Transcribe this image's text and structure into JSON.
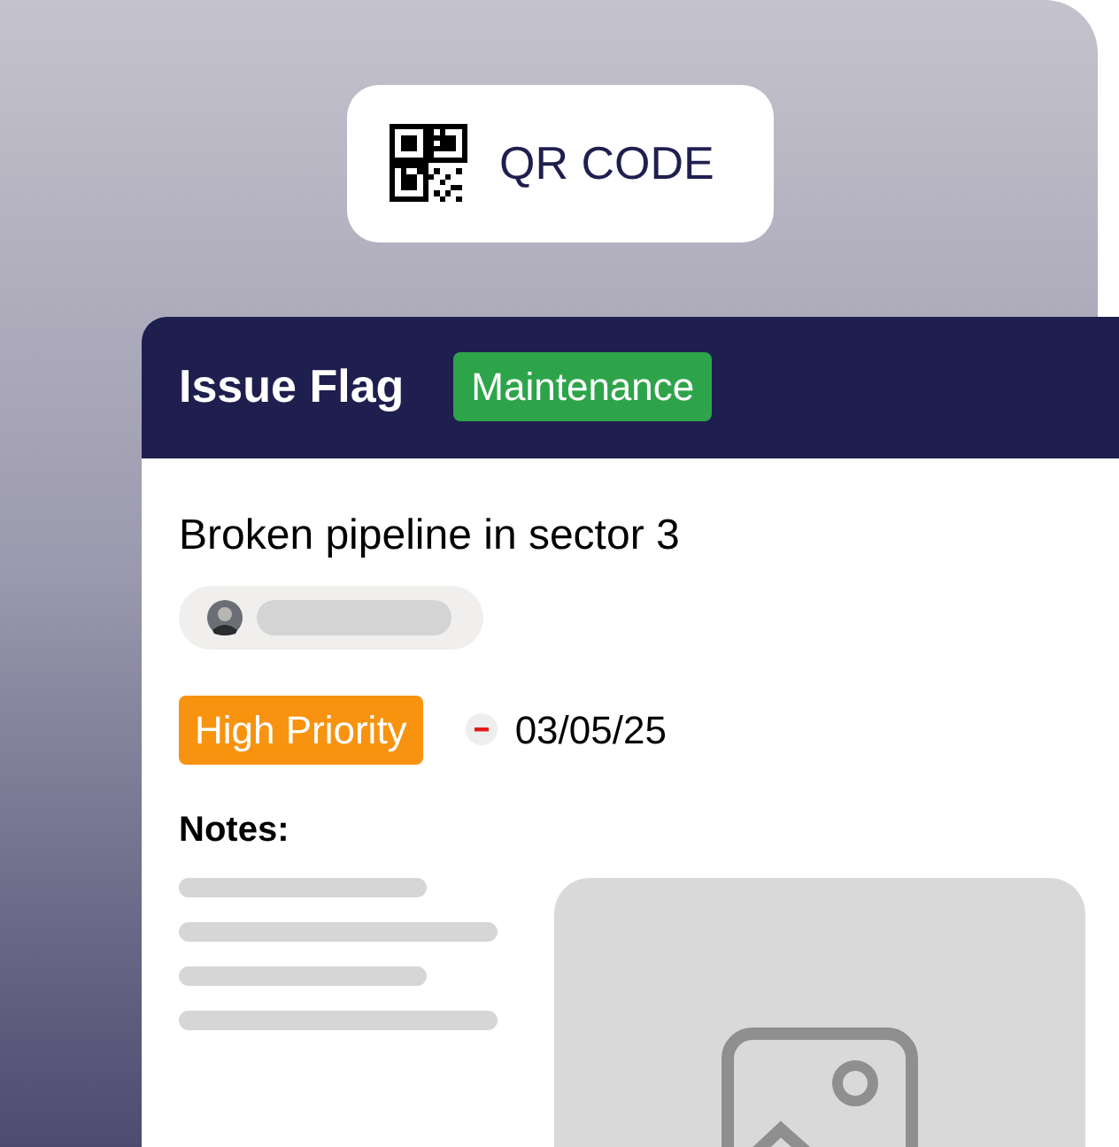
{
  "qr_button": {
    "label": "QR CODE"
  },
  "card": {
    "title": "Issue Flag",
    "tag": "Maintenance",
    "issue": "Broken pipeline in sector 3",
    "priority": "High Priority",
    "date": "03/05/25",
    "notes_label": "Notes:"
  }
}
